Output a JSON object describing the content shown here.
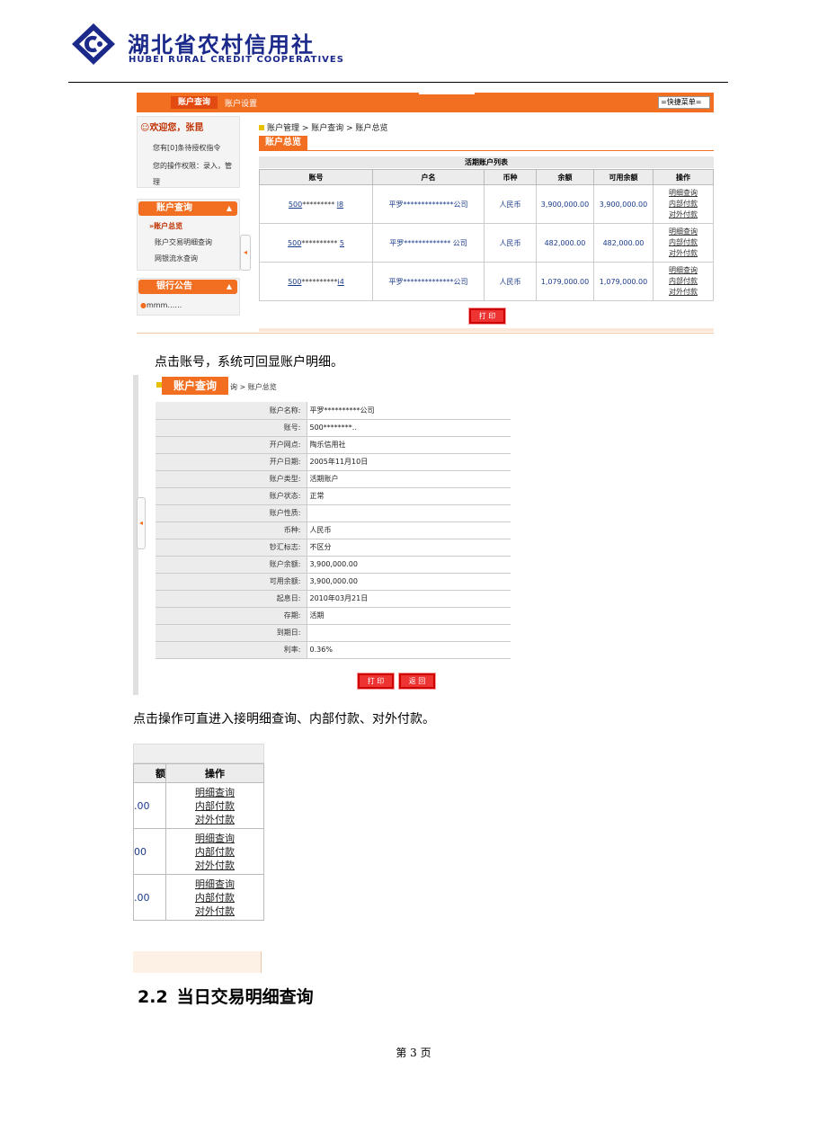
{
  "header": {
    "org_name_cn": "湖北省农村信用社",
    "org_name_en": "HUBEI RURAL CREDIT COOPERATIVES"
  },
  "screen1": {
    "nav_tabs": [
      "账户查询",
      "账户设置"
    ],
    "quick_menu": "=快捷菜单=",
    "welcome": "欢迎您，张昆",
    "pending": "您有[0]条待授权指令",
    "permission_1": "您的操作权限：录入，管",
    "permission_2": "理",
    "menu_account": "账户查询",
    "menu_items": [
      "账户总览",
      "账户交易明细查询",
      "网银流水查询"
    ],
    "menu_notice": "银行公告",
    "notice_item": "mmm……",
    "breadcrumb": "账户管理 > 账户查询 > 账户总览",
    "tab_title": "账户总览",
    "list_title": "活期账户列表",
    "columns": [
      "账号",
      "户名",
      "币种",
      "余额",
      "可用余额",
      "操作"
    ],
    "rows": [
      {
        "acc_prefix": "500",
        "acc_mask": "*********",
        "acc_suffix": "l8",
        "name": "平罗**************公司",
        "currency": "人民币",
        "balance": "3,900,000.00",
        "available": "3,900,000.00"
      },
      {
        "acc_prefix": "500",
        "acc_mask": "**********",
        "acc_suffix": "5",
        "name": "平罗************* 公司",
        "currency": "人民币",
        "balance": "482,000.00",
        "available": "482,000.00"
      },
      {
        "acc_prefix": "500",
        "acc_mask": "**********",
        "acc_suffix": "i4",
        "name": "平罗**************公司",
        "currency": "人民币",
        "balance": "1,079,000.00",
        "available": "1,079,000.00"
      }
    ],
    "ops": [
      "明细查询",
      "内部付款",
      "对外付款"
    ],
    "print_btn": "打 印"
  },
  "para1": "点击账号，系统可回显账户明细。",
  "screen2": {
    "tab_title": "账户查询",
    "crumb": "询 > 账户总览",
    "fields": [
      {
        "label": "账户名称:",
        "value": "平罗**********公司"
      },
      {
        "label": "账号:",
        "value": "500********.."
      },
      {
        "label": "开户网点:",
        "value": "陶乐信用社"
      },
      {
        "label": "开户日期:",
        "value": "2005年11月10日"
      },
      {
        "label": "账户类型:",
        "value": "活期账户"
      },
      {
        "label": "账户状态:",
        "value": "正常"
      },
      {
        "label": "账户性质:",
        "value": ""
      },
      {
        "label": "币种:",
        "value": "人民币"
      },
      {
        "label": "钞汇标志:",
        "value": "不区分"
      },
      {
        "label": "账户余额:",
        "value": "3,900,000.00"
      },
      {
        "label": "可用余额:",
        "value": "3,900,000.00"
      },
      {
        "label": "起息日:",
        "value": "2010年03月21日"
      },
      {
        "label": "存期:",
        "value": "活期"
      },
      {
        "label": "到期日:",
        "value": ""
      },
      {
        "label": "利率:",
        "value": "0.36%"
      }
    ],
    "print_btn": "打 印",
    "back_btn": "返 回"
  },
  "para2": "点击操作可直进入接明细查询、内部付款、对外付款。",
  "screen3": {
    "col_partial": "额",
    "col_ops": "操作",
    "rows": [
      ".00",
      "00",
      ".00"
    ],
    "ops": [
      "明细查询",
      "内部付款",
      "对外付款"
    ]
  },
  "section": {
    "number": "2.2",
    "title": "当日交易明细查询"
  },
  "page_number": "第 3 页"
}
